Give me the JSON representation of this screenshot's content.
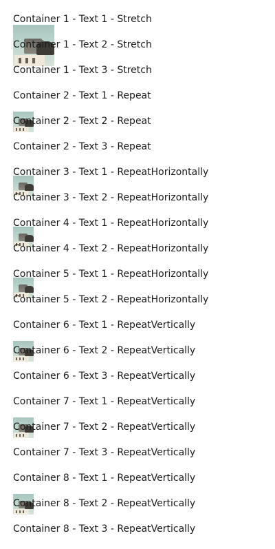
{
  "containers": [
    {
      "items": [
        "Container 1 - Text 1 - Stretch",
        "Container 1 - Text 2 - Stretch",
        "Container 1 - Text 3 - Stretch"
      ]
    },
    {
      "items": [
        "Container 2 - Text 1 - Repeat",
        "Container 2 - Text 2 - Repeat",
        "Container 2 - Text 3 - Repeat"
      ]
    },
    {
      "items": [
        "Container 3 - Text 1 - RepeatHorizontally",
        "Container 3 - Text 2 - RepeatHorizontally"
      ]
    },
    {
      "items": [
        "Container 4 - Text 1 - RepeatHorizontally",
        "Container 4 - Text 2 - RepeatHorizontally"
      ]
    },
    {
      "items": [
        "Container 5 - Text 1 - RepeatHorizontally",
        "Container 5 - Text 2 - RepeatHorizontally"
      ]
    },
    {
      "items": [
        "Container 6 - Text 1 - RepeatVertically",
        "Container 6 - Text 2 - RepeatVertically",
        "Container 6 - Text 3 - RepeatVertically"
      ]
    },
    {
      "items": [
        "Container 7 - Text 1 - RepeatVertically",
        "Container 7 - Text 2 - RepeatVertically",
        "Container 7 - Text 3 - RepeatVertically"
      ]
    },
    {
      "items": [
        "Container 8 - Text 1 - RepeatVertically",
        "Container 8 - Text 2 - RepeatVertically",
        "Container 8 - Text 3 - RepeatVertically"
      ]
    }
  ]
}
